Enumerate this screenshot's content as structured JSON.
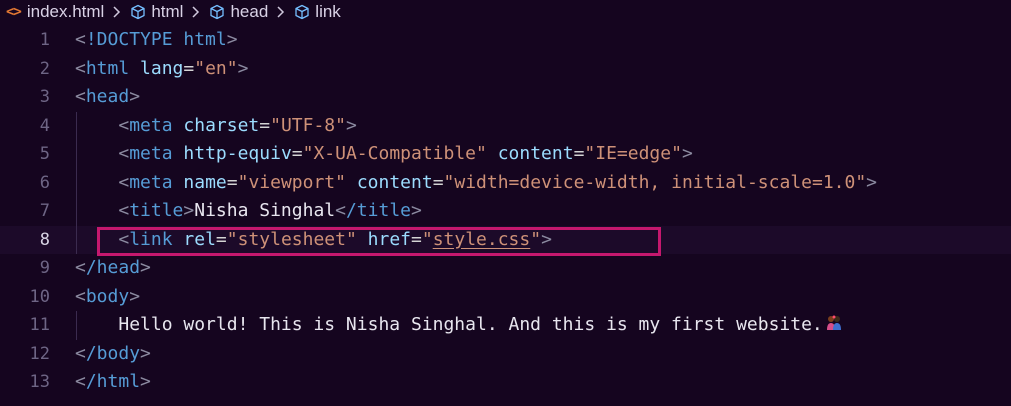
{
  "breadcrumb": {
    "file": "index.html",
    "items": [
      "html",
      "head",
      "link"
    ]
  },
  "lines": [
    {
      "no": "1"
    },
    {
      "no": "2"
    },
    {
      "no": "3"
    },
    {
      "no": "4"
    },
    {
      "no": "5"
    },
    {
      "no": "6"
    },
    {
      "no": "7"
    },
    {
      "no": "8"
    },
    {
      "no": "9"
    },
    {
      "no": "10"
    },
    {
      "no": "11"
    },
    {
      "no": "12"
    },
    {
      "no": "13"
    }
  ],
  "code": {
    "l1": {
      "bracket_open": "<",
      "tag": "!DOCTYPE",
      "rest": " html",
      "bracket_close": ">"
    },
    "l2": {
      "tag": "html",
      "attr": "lang",
      "val": "\"en\""
    },
    "l3": {
      "tag": "head"
    },
    "l4": {
      "tag": "meta",
      "attr": "charset",
      "val": "\"UTF-8\""
    },
    "l5": {
      "tag": "meta",
      "attr1": "http-equiv",
      "val1": "\"X-UA-Compatible\"",
      "attr2": "content",
      "val2": "\"IE=edge\""
    },
    "l6": {
      "tag": "meta",
      "attr1": "name",
      "val1": "\"viewport\"",
      "attr2": "content",
      "val2": "\"width=device-width, initial-scale=1.0\""
    },
    "l7": {
      "tag": "title",
      "text": "Nisha Singhal",
      "close_tag": "/title"
    },
    "l8": {
      "tag": "link",
      "attr1": "rel",
      "val1": "\"stylesheet\"",
      "attr2": "href",
      "val2_q1": "\"",
      "val2": "style.css",
      "val2_q2": "\""
    },
    "l9": {
      "tag": "/head"
    },
    "l10": {
      "tag": "body"
    },
    "l11": {
      "text": "Hello world! This is Nisha Singhal. And this is my first website."
    },
    "l12": {
      "tag": "/body"
    },
    "l13": {
      "tag": "/html"
    }
  },
  "colors": {
    "background": "#15051f",
    "highlight_border": "#c5186e"
  },
  "icons": {
    "file_icon": "html-file-icon",
    "crumb_icon": "cube-icon",
    "emoji": "couple-emoji"
  }
}
